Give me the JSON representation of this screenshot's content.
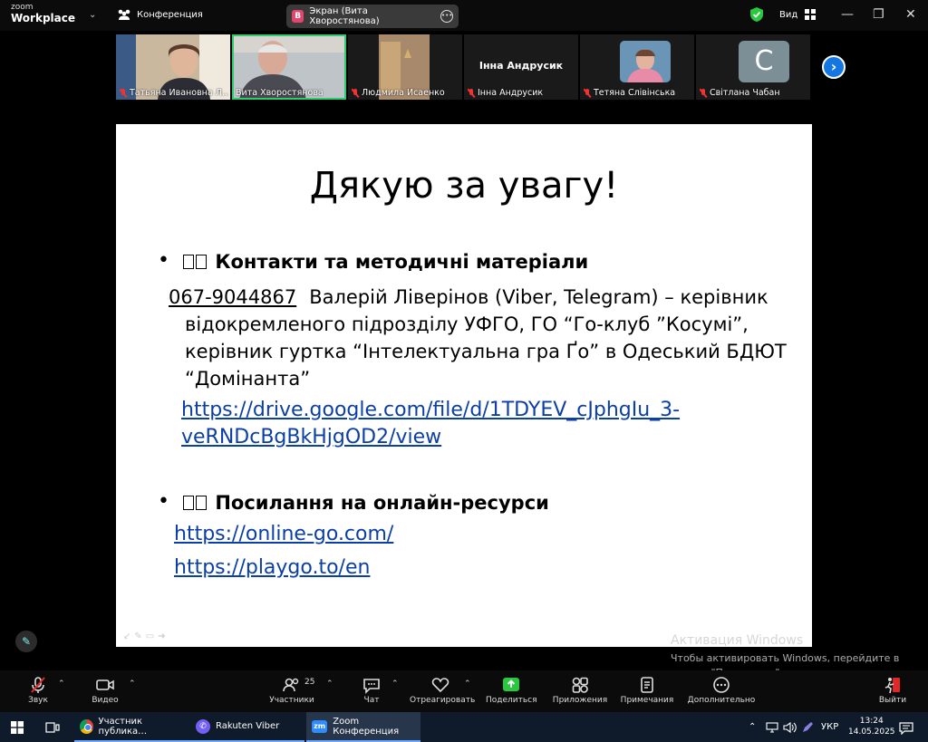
{
  "titlebar": {
    "logo_top": "zoom",
    "logo_bottom": "Workplace",
    "conference_label": "Конференция",
    "share_pill_badge": "В",
    "share_pill_label": "Экран (Вита Хворостянова)",
    "view_label": "Вид",
    "minimize": "—",
    "maximize": "❐",
    "close": "✕"
  },
  "participants": [
    {
      "name": "Татьяна Ивановна Л…",
      "muted": true,
      "video": true
    },
    {
      "name": "Вита Хворостянова",
      "muted": false,
      "video": true,
      "active": true
    },
    {
      "name": "Людмила Исаенко",
      "muted": true,
      "video": true
    },
    {
      "name": "Інна Андрусик",
      "muted": true,
      "video": false,
      "display_name": "Інна Андрусик"
    },
    {
      "name": "Тетяна Слівінська",
      "muted": true,
      "video": true
    },
    {
      "name": "Світлана Чабан",
      "muted": true,
      "video": false,
      "avatar_letter": "С"
    }
  ],
  "strip_next": "›",
  "slide": {
    "title": "Дякую за увагу!",
    "section1_heading": "Контакти та методичні матеріали",
    "phone": "067-9044867",
    "contact_text": "Валерій Ліверінов (Viber, Telegram) – керівник відокремленого підрозділу УФГО, ГО “Го-клуб ”Косумі”, керівник гуртка “Інтелектуальна гра Ґо” в Одеський БДЮТ “Домінанта”",
    "drive_link": "https://drive.google.com/file/d/1TDYEV_cJphgIu_3-veRNDcBgBkHjgOD2/view",
    "section2_heading": "Посилання на онлайн-ресурси",
    "link_online_go": "https://online-go.com/",
    "link_playgo": "https://playgo.to/en",
    "bullet": "•"
  },
  "watermark": {
    "line1": "Активация Windows",
    "line2": "Чтобы активировать Windows, перейдите в раздел \"Параметры\"."
  },
  "toolbar": {
    "audio": "Звук",
    "video": "Видео",
    "participants": "Участники",
    "participants_count": "25",
    "chat": "Чат",
    "react": "Отреагировать",
    "share": "Поделиться",
    "apps": "Приложения",
    "notes": "Примечания",
    "more": "Дополнительно",
    "leave": "Выйти"
  },
  "taskbar": {
    "app1": "Участник публика…",
    "app2": "Rakuten Viber",
    "app3": "Zoom Конференция",
    "zoom_icon_text": "zm",
    "viber_icon_text": "✆",
    "lang": "УКР",
    "time": "13:24",
    "date": "14.05.2025"
  },
  "colors": {
    "active_outline": "#2ecc71",
    "share_green": "#27c93f",
    "leave_red": "#e02828",
    "link_blue": "#0b3fa8"
  }
}
